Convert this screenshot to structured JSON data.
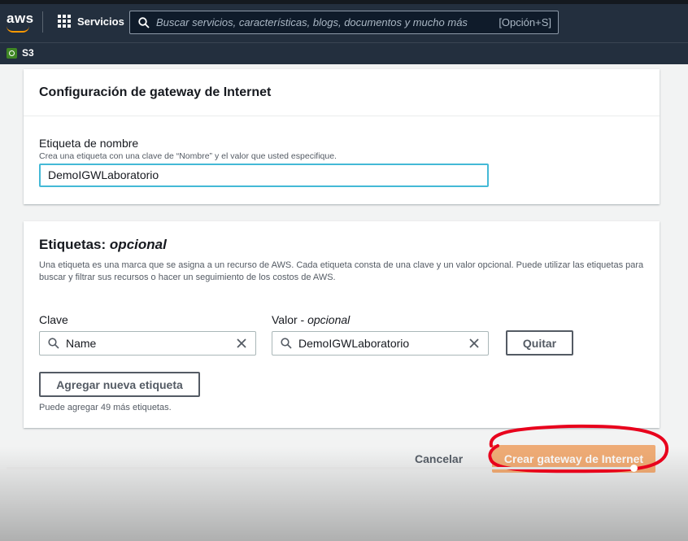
{
  "topbar": {
    "logo": "aws",
    "services_label": "Servicios",
    "search_placeholder": "Buscar servicios, características, blogs, documentos y mucho más",
    "search_shortcut": "[Opción+S]"
  },
  "favorites": {
    "s3_label": "S3"
  },
  "config_card": {
    "title": "Configuración de gateway de Internet",
    "name_tag_label": "Etiqueta de nombre",
    "name_tag_description": "Crea una etiqueta con una clave de “Nombre” y el valor que usted especifique.",
    "name_tag_value": "DemoIGWLaboratorio"
  },
  "tags_card": {
    "title": "Etiquetas:",
    "title_optional": "opcional",
    "description": "Una etiqueta es una marca que se asigna a un recurso de AWS. Cada etiqueta consta de una clave y un valor opcional. Puede utilizar las etiquetas para buscar y filtrar sus recursos o hacer un seguimiento de los costos de AWS.",
    "key_label": "Clave",
    "value_label": "Valor -",
    "value_label_optional": "opcional",
    "key_value": "Name",
    "value_value": "DemoIGWLaboratorio",
    "remove_button": "Quitar",
    "add_button": "Agregar nueva etiqueta",
    "remaining_text": "Puede agregar 49 más etiquetas."
  },
  "footer": {
    "cancel_label": "Cancelar",
    "create_label": "Crear gateway de Internet"
  },
  "icons": [
    "services-grid-icon",
    "search-icon",
    "s3-icon",
    "clear-icon"
  ],
  "colors": {
    "header_bg": "#232f3e",
    "primary_button": "#ec7211",
    "focus_border": "#44b9d6",
    "annotation": "#e8001c"
  }
}
